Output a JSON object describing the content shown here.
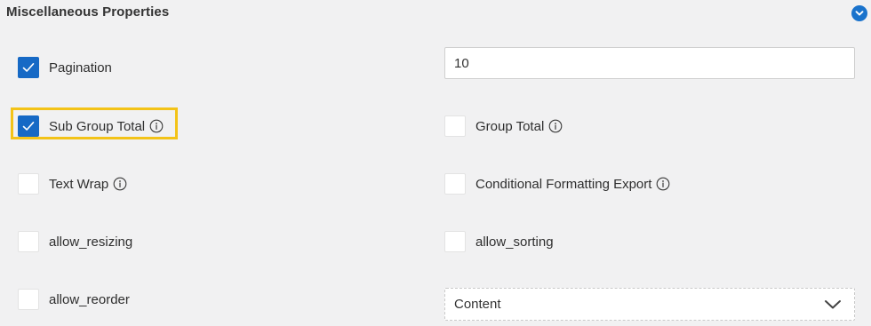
{
  "section": {
    "title": "Miscellaneous Properties"
  },
  "options": {
    "pagination": {
      "label": "Pagination",
      "checked": true
    },
    "pagination_size": {
      "value": "10"
    },
    "sub_group_total": {
      "label": "Sub Group Total",
      "checked": true
    },
    "group_total": {
      "label": "Group Total",
      "checked": false
    },
    "text_wrap": {
      "label": "Text Wrap",
      "checked": false
    },
    "conditional_formatting_export": {
      "label": "Conditional Formatting Export",
      "checked": false
    },
    "allow_resizing": {
      "label": "allow_resizing",
      "checked": false
    },
    "allow_sorting": {
      "label": "allow_sorting",
      "checked": false
    },
    "allow_reorder": {
      "label": "allow_reorder",
      "checked": false
    },
    "content_select": {
      "value": "Content"
    }
  },
  "icons": {
    "collapse": "chevron-down-circle-icon",
    "info": "info-circle-icon",
    "check": "checkmark-icon",
    "dropdown": "chevron-down-icon"
  },
  "colors": {
    "accent": "#1669c5",
    "highlight": "#f3c318",
    "background": "#f1f1f2"
  }
}
